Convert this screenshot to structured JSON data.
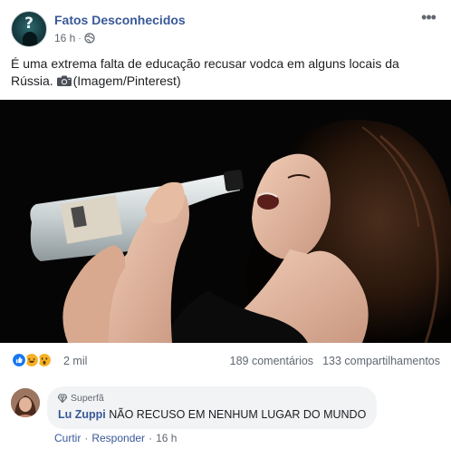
{
  "post": {
    "page_name": "Fatos Desconhecidos",
    "time": "16 h",
    "separator": "·",
    "audience_icon": "globe-icon",
    "more_icon": "ellipsis-icon",
    "text_main": "É uma extrema falta de educação recusar vodca em alguns locais da Rússia.",
    "camera_icon": "camera-icon",
    "text_credit": "(Imagem/Pinterest)"
  },
  "reactions": {
    "icons": [
      "like-icon",
      "haha-icon",
      "wow-icon"
    ],
    "colors": {
      "like": "#1877f2",
      "haha": "#f7b125",
      "wow": "#f7b125"
    },
    "count": "2 mil",
    "comments": "189 comentários",
    "shares": "133 compartilhamentos"
  },
  "comment": {
    "badge": "Superfã",
    "author": "Lu Zuppi",
    "text": "NÃO RECUSO EM NENHUM LUGAR DO MUNDO",
    "actions": {
      "like": "Curtir",
      "reply": "Responder",
      "time": "16 h",
      "separator": "·"
    }
  },
  "colors": {
    "link": "#385898",
    "meta": "#606770",
    "bubble": "#f2f3f5"
  }
}
